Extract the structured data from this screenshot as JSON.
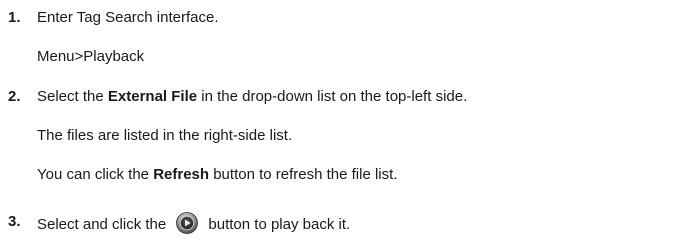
{
  "steps": [
    {
      "number": "1.",
      "text": "Enter Tag Search interface.",
      "sub": [
        "Menu>Playback"
      ]
    },
    {
      "number": "2.",
      "text_before": "Select the ",
      "bold": "External File",
      "text_after": " in the drop-down list on the top-left side.",
      "sub1": "The files are listed in the right-side list.",
      "sub2_before": "You can click the ",
      "sub2_bold": "Refresh",
      "sub2_after": " button to refresh the file list."
    },
    {
      "number": "3.",
      "text_before": "Select and click the ",
      "icon": "play-button-icon",
      "text_after": "button to play back it."
    }
  ]
}
